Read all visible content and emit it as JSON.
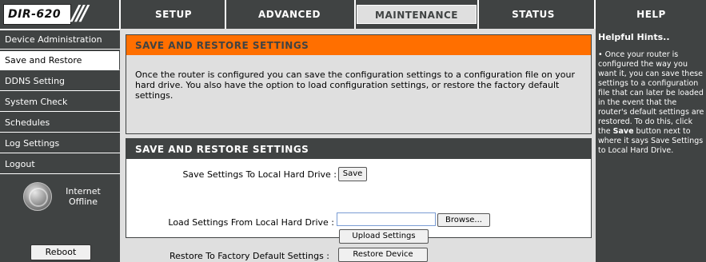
{
  "header": {
    "logo": "DIR-620",
    "tabs": [
      {
        "label": "SETUP"
      },
      {
        "label": "ADVANCED"
      },
      {
        "label": "MAINTENANCE"
      },
      {
        "label": "STATUS"
      },
      {
        "label": "HELP"
      }
    ],
    "active_tab": "MAINTENANCE"
  },
  "sidebar": {
    "items": [
      {
        "label": "Device Administration"
      },
      {
        "label": "Save and Restore"
      },
      {
        "label": "DDNS Setting"
      },
      {
        "label": "System Check"
      },
      {
        "label": "Schedules"
      },
      {
        "label": "Log Settings"
      },
      {
        "label": "Logout"
      }
    ],
    "active_item": "Save and Restore",
    "status": {
      "line1": "Internet",
      "line2": "Offline",
      "icon": "globe-icon"
    },
    "reboot_label": "Reboot"
  },
  "main": {
    "intro": {
      "title": "SAVE AND RESTORE SETTINGS",
      "text": "Once the router is configured you can save the configuration settings to a configuration file on your hard drive. You also have the option to load configuration settings, or restore the factory default settings."
    },
    "form": {
      "title": "SAVE AND RESTORE SETTINGS",
      "save_label": "Save Settings To Local Hard Drive :",
      "save_button": "Save",
      "load_label": "Load Settings From Local Hard Drive :",
      "file_value": "",
      "browse_button": "Browse...",
      "upload_button": "Upload Settings",
      "restore_label": "Restore To Factory Default Settings :",
      "restore_button": "Restore Device"
    }
  },
  "help": {
    "title": "Helpful Hints..",
    "bullet": "•",
    "text_before": "Once your router is configured the way you want it, you can save these settings to a configuration file that can later be loaded in the event that the router's default settings are restored. To do this, click the",
    "bold_word": "Save",
    "text_after": "button next to where it says Save Settings to Local Hard Drive."
  },
  "colors": {
    "dark_gray": "#404343",
    "orange_header": "#ff6f00",
    "content_gray": "#dfdfdf",
    "white": "#ffffff"
  }
}
